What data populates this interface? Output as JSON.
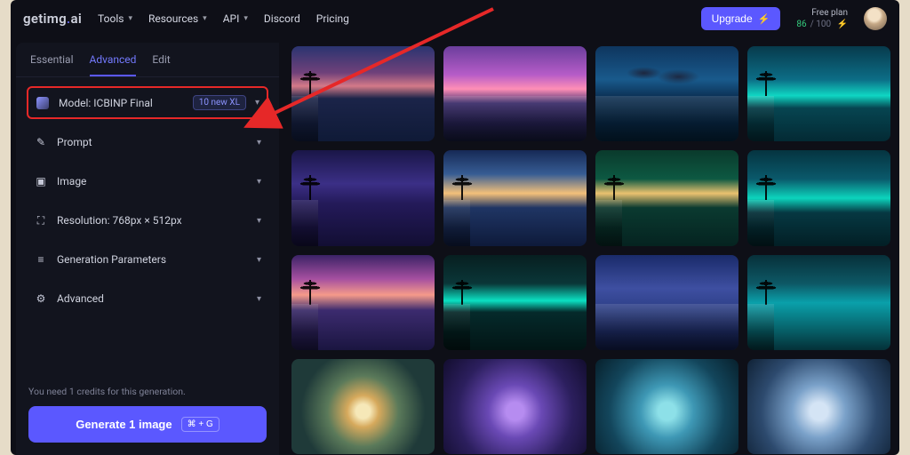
{
  "header": {
    "logo_get": "getimg",
    "logo_dot": ".",
    "logo_ai": "ai",
    "nav": {
      "tools": "Tools",
      "resources": "Resources",
      "api": "API",
      "discord": "Discord",
      "pricing": "Pricing"
    },
    "upgrade": "Upgrade",
    "plan_label": "Free plan",
    "credit_used": "86",
    "credit_max": "/ 100"
  },
  "tabs": {
    "essential": "Essential",
    "advanced": "Advanced",
    "edit": "Edit"
  },
  "sidebar": {
    "model_label": "Model: ICBINP Final",
    "model_badge": "10 new XL",
    "prompt": "Prompt",
    "image": "Image",
    "resolution": "Resolution: 768px × 512px",
    "params": "Generation Parameters",
    "advanced": "Advanced"
  },
  "bottom": {
    "credits": "You need 1 credits for this generation.",
    "generate": "Generate 1 image",
    "shortcut": "⌘ + G"
  }
}
